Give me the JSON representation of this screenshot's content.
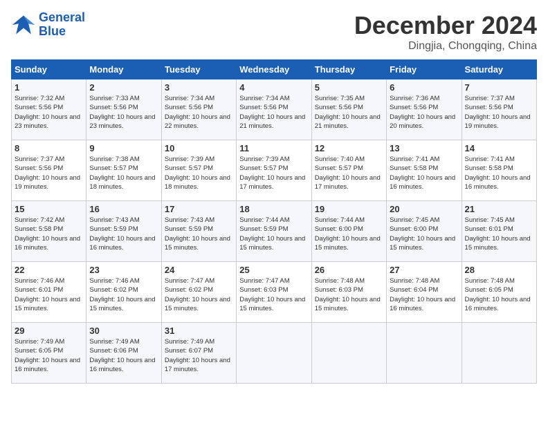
{
  "logo": {
    "line1": "General",
    "line2": "Blue"
  },
  "title": "December 2024",
  "subtitle": "Dingjia, Chongqing, China",
  "weekdays": [
    "Sunday",
    "Monday",
    "Tuesday",
    "Wednesday",
    "Thursday",
    "Friday",
    "Saturday"
  ],
  "weeks": [
    [
      {
        "day": "1",
        "sunrise": "Sunrise: 7:32 AM",
        "sunset": "Sunset: 5:56 PM",
        "daylight": "Daylight: 10 hours and 23 minutes."
      },
      {
        "day": "2",
        "sunrise": "Sunrise: 7:33 AM",
        "sunset": "Sunset: 5:56 PM",
        "daylight": "Daylight: 10 hours and 23 minutes."
      },
      {
        "day": "3",
        "sunrise": "Sunrise: 7:34 AM",
        "sunset": "Sunset: 5:56 PM",
        "daylight": "Daylight: 10 hours and 22 minutes."
      },
      {
        "day": "4",
        "sunrise": "Sunrise: 7:34 AM",
        "sunset": "Sunset: 5:56 PM",
        "daylight": "Daylight: 10 hours and 21 minutes."
      },
      {
        "day": "5",
        "sunrise": "Sunrise: 7:35 AM",
        "sunset": "Sunset: 5:56 PM",
        "daylight": "Daylight: 10 hours and 21 minutes."
      },
      {
        "day": "6",
        "sunrise": "Sunrise: 7:36 AM",
        "sunset": "Sunset: 5:56 PM",
        "daylight": "Daylight: 10 hours and 20 minutes."
      },
      {
        "day": "7",
        "sunrise": "Sunrise: 7:37 AM",
        "sunset": "Sunset: 5:56 PM",
        "daylight": "Daylight: 10 hours and 19 minutes."
      }
    ],
    [
      {
        "day": "8",
        "sunrise": "Sunrise: 7:37 AM",
        "sunset": "Sunset: 5:56 PM",
        "daylight": "Daylight: 10 hours and 19 minutes."
      },
      {
        "day": "9",
        "sunrise": "Sunrise: 7:38 AM",
        "sunset": "Sunset: 5:57 PM",
        "daylight": "Daylight: 10 hours and 18 minutes."
      },
      {
        "day": "10",
        "sunrise": "Sunrise: 7:39 AM",
        "sunset": "Sunset: 5:57 PM",
        "daylight": "Daylight: 10 hours and 18 minutes."
      },
      {
        "day": "11",
        "sunrise": "Sunrise: 7:39 AM",
        "sunset": "Sunset: 5:57 PM",
        "daylight": "Daylight: 10 hours and 17 minutes."
      },
      {
        "day": "12",
        "sunrise": "Sunrise: 7:40 AM",
        "sunset": "Sunset: 5:57 PM",
        "daylight": "Daylight: 10 hours and 17 minutes."
      },
      {
        "day": "13",
        "sunrise": "Sunrise: 7:41 AM",
        "sunset": "Sunset: 5:58 PM",
        "daylight": "Daylight: 10 hours and 16 minutes."
      },
      {
        "day": "14",
        "sunrise": "Sunrise: 7:41 AM",
        "sunset": "Sunset: 5:58 PM",
        "daylight": "Daylight: 10 hours and 16 minutes."
      }
    ],
    [
      {
        "day": "15",
        "sunrise": "Sunrise: 7:42 AM",
        "sunset": "Sunset: 5:58 PM",
        "daylight": "Daylight: 10 hours and 16 minutes."
      },
      {
        "day": "16",
        "sunrise": "Sunrise: 7:43 AM",
        "sunset": "Sunset: 5:59 PM",
        "daylight": "Daylight: 10 hours and 16 minutes."
      },
      {
        "day": "17",
        "sunrise": "Sunrise: 7:43 AM",
        "sunset": "Sunset: 5:59 PM",
        "daylight": "Daylight: 10 hours and 15 minutes."
      },
      {
        "day": "18",
        "sunrise": "Sunrise: 7:44 AM",
        "sunset": "Sunset: 5:59 PM",
        "daylight": "Daylight: 10 hours and 15 minutes."
      },
      {
        "day": "19",
        "sunrise": "Sunrise: 7:44 AM",
        "sunset": "Sunset: 6:00 PM",
        "daylight": "Daylight: 10 hours and 15 minutes."
      },
      {
        "day": "20",
        "sunrise": "Sunrise: 7:45 AM",
        "sunset": "Sunset: 6:00 PM",
        "daylight": "Daylight: 10 hours and 15 minutes."
      },
      {
        "day": "21",
        "sunrise": "Sunrise: 7:45 AM",
        "sunset": "Sunset: 6:01 PM",
        "daylight": "Daylight: 10 hours and 15 minutes."
      }
    ],
    [
      {
        "day": "22",
        "sunrise": "Sunrise: 7:46 AM",
        "sunset": "Sunset: 6:01 PM",
        "daylight": "Daylight: 10 hours and 15 minutes."
      },
      {
        "day": "23",
        "sunrise": "Sunrise: 7:46 AM",
        "sunset": "Sunset: 6:02 PM",
        "daylight": "Daylight: 10 hours and 15 minutes."
      },
      {
        "day": "24",
        "sunrise": "Sunrise: 7:47 AM",
        "sunset": "Sunset: 6:02 PM",
        "daylight": "Daylight: 10 hours and 15 minutes."
      },
      {
        "day": "25",
        "sunrise": "Sunrise: 7:47 AM",
        "sunset": "Sunset: 6:03 PM",
        "daylight": "Daylight: 10 hours and 15 minutes."
      },
      {
        "day": "26",
        "sunrise": "Sunrise: 7:48 AM",
        "sunset": "Sunset: 6:03 PM",
        "daylight": "Daylight: 10 hours and 15 minutes."
      },
      {
        "day": "27",
        "sunrise": "Sunrise: 7:48 AM",
        "sunset": "Sunset: 6:04 PM",
        "daylight": "Daylight: 10 hours and 16 minutes."
      },
      {
        "day": "28",
        "sunrise": "Sunrise: 7:48 AM",
        "sunset": "Sunset: 6:05 PM",
        "daylight": "Daylight: 10 hours and 16 minutes."
      }
    ],
    [
      {
        "day": "29",
        "sunrise": "Sunrise: 7:49 AM",
        "sunset": "Sunset: 6:05 PM",
        "daylight": "Daylight: 10 hours and 16 minutes."
      },
      {
        "day": "30",
        "sunrise": "Sunrise: 7:49 AM",
        "sunset": "Sunset: 6:06 PM",
        "daylight": "Daylight: 10 hours and 16 minutes."
      },
      {
        "day": "31",
        "sunrise": "Sunrise: 7:49 AM",
        "sunset": "Sunset: 6:07 PM",
        "daylight": "Daylight: 10 hours and 17 minutes."
      },
      null,
      null,
      null,
      null
    ]
  ]
}
